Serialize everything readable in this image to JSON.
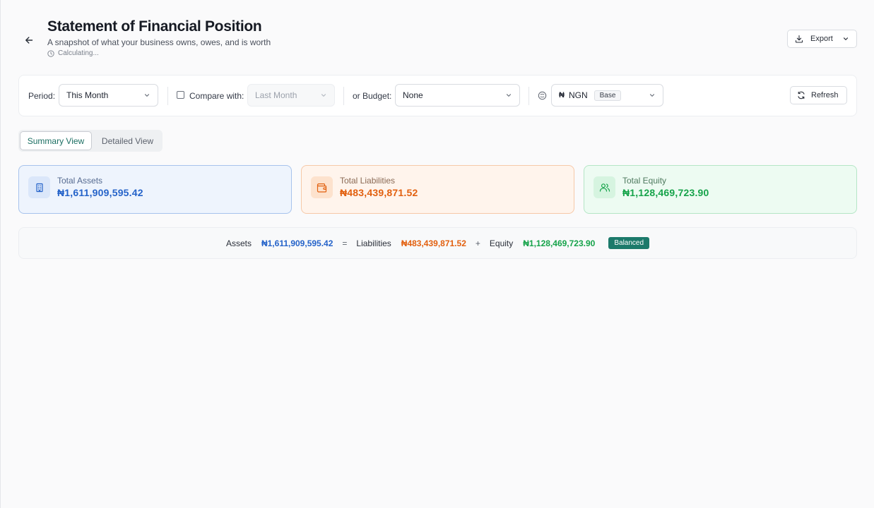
{
  "header": {
    "title": "Statement of Financial Position",
    "subtitle": "A snapshot of what your business owns, owes, and is worth",
    "status": "Calculating...",
    "export_label": "Export"
  },
  "filters": {
    "period_label": "Period:",
    "period_value": "This Month",
    "compare_label": "Compare with:",
    "compare_value": "Last Month",
    "compare_checked": false,
    "budget_label": "or Budget:",
    "budget_value": "None",
    "currency_symbol": "₦",
    "currency_code": "NGN",
    "currency_badge": "Base",
    "refresh_label": "Refresh"
  },
  "views": {
    "summary_label": "Summary View",
    "detailed_label": "Detailed View",
    "active": "summary"
  },
  "cards": {
    "assets": {
      "label": "Total Assets",
      "value": "₦1,611,909,595.42",
      "icon": "building-icon",
      "color": "#2563c9"
    },
    "liabilities": {
      "label": "Total Liabilities",
      "value": "₦483,439,871.52",
      "icon": "wallet-icon",
      "color": "#e2600f"
    },
    "equity": {
      "label": "Total Equity",
      "value": "₦1,128,469,723.90",
      "icon": "users-icon",
      "color": "#16a34a"
    }
  },
  "equation": {
    "assets_label": "Assets",
    "assets_value": "₦1,611,909,595.42",
    "equals": "=",
    "liabilities_label": "Liabilities",
    "liabilities_value": "₦483,439,871.52",
    "plus": "+",
    "equity_label": "Equity",
    "equity_value": "₦1,128,469,723.90",
    "badge": "Balanced"
  }
}
